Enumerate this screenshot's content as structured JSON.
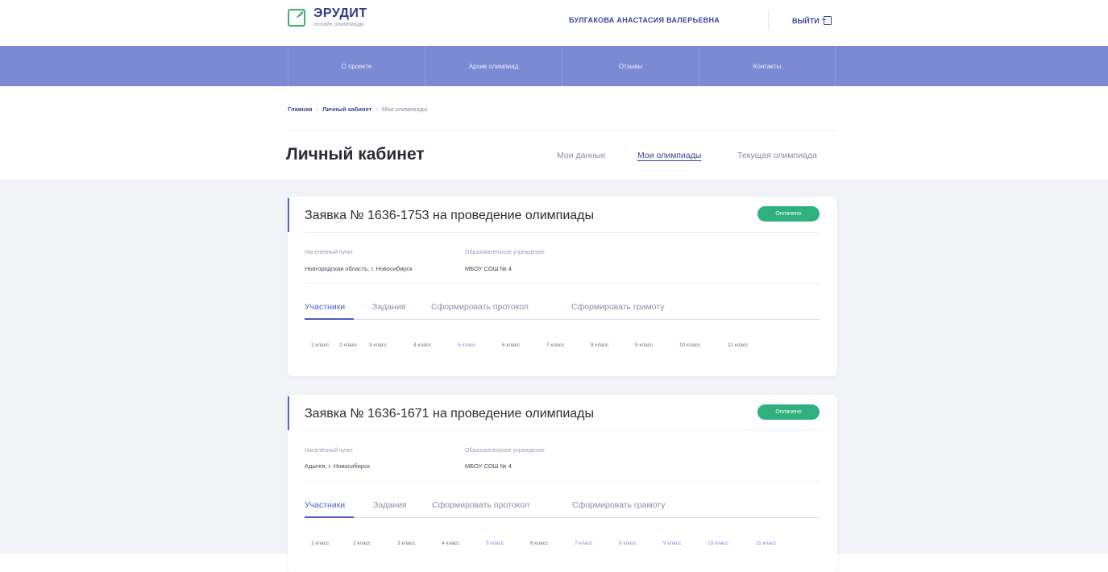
{
  "header": {
    "logo_title": "ЭРУДИТ",
    "logo_subtitle": "онлайн олимпиады",
    "user_name": "БУЛГАКОВА АНАСТАСИЯ ВАЛЕРЬЕВНА",
    "logout_label": "ВЫЙТИ"
  },
  "nav": {
    "items": [
      {
        "label": "О проекте"
      },
      {
        "label": "Архив олимпиад"
      },
      {
        "label": "Отзывы"
      },
      {
        "label": "Контакты"
      }
    ]
  },
  "breadcrumb": {
    "items": [
      {
        "label": "Главная"
      },
      {
        "label": "Личный кабинет"
      },
      {
        "label": "Мои олимпиады"
      }
    ],
    "separator": "›"
  },
  "page": {
    "title": "Личный кабинет",
    "tabs": [
      {
        "label": "Мои данные",
        "active": false
      },
      {
        "label": "Мои олимпиады",
        "active": true
      },
      {
        "label": "Текущая олимпиада",
        "active": false
      }
    ]
  },
  "colors": {
    "nav_bg": "#7b8ad2",
    "accent": "#3a4698",
    "status_paid": "#2fb07e",
    "content_bg": "#f1f3f7"
  },
  "applications": [
    {
      "title": "Заявка № 1636-1753 на проведение олимпиады",
      "status": "Оплачено",
      "locality_label": "Населённый пункт",
      "locality_value": "Новгородская область, г. Новосибирск",
      "school_label": "Образовательное учреждение",
      "school_value": "МБОУ СОШ № 4",
      "tabs": [
        "Участники",
        "Задания",
        "Сформировать протокол",
        "Сформировать грамоту"
      ],
      "active_tab": "Участники",
      "grades": [
        "1 класс",
        "2 класс",
        "3 класс",
        "4 класс",
        "5 класс",
        "6 класс",
        "7 класс",
        "8 класс",
        "9 класс",
        "10 класс",
        "11 класс"
      ],
      "highlighted_grades": [
        "5 класс"
      ]
    },
    {
      "title": "Заявка № 1636-1671 на проведение олимпиады",
      "status": "Оплачено",
      "locality_label": "Населённый пункт",
      "locality_value": "Адыгея, г. Новосибирск",
      "school_label": "Образовательное учреждение",
      "school_value": "МБОУ СОШ № 4",
      "tabs": [
        "Участники",
        "Задания",
        "Сформировать протокол",
        "Сформировать грамоту"
      ],
      "active_tab": "Участники",
      "grades": [
        "1 класс",
        "2 класс",
        "3 класс",
        "4 класс",
        "5 класс",
        "6 класс",
        "7 класс",
        "8 класс",
        "9 класс",
        "10 класс",
        "11 класс"
      ],
      "highlighted_grades": [
        "5 класс",
        "7 класс",
        "8 класс",
        "9 класс",
        "10 класс",
        "11 класс"
      ]
    }
  ]
}
